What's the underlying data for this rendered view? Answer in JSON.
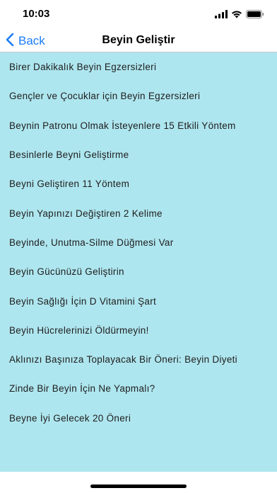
{
  "status": {
    "time": "10:03",
    "icons": [
      "signal-icon",
      "wifi-icon",
      "battery-icon"
    ]
  },
  "nav": {
    "back_label": "Back",
    "title": "Beyin Geliştir"
  },
  "colors": {
    "accent": "#1a7cf5",
    "list_background": "#aee6ef"
  },
  "items": [
    {
      "label": "Birer Dakikalık Beyin Egzersizleri"
    },
    {
      "label": "Gençler ve Çocuklar için Beyin Egzersizleri"
    },
    {
      "label": "Beynin Patronu Olmak İsteyenlere 15 Etkili Yöntem"
    },
    {
      "label": "Besinlerle Beyni Geliştirme"
    },
    {
      "label": "Beyni Geliştiren 11 Yöntem"
    },
    {
      "label": "Beyin Yapınızı Değiştiren 2 Kelime"
    },
    {
      "label": "Beyinde, Unutma-Silme Düğmesi Var"
    },
    {
      "label": "Beyin Gücünüzü Geliştirin"
    },
    {
      "label": "Beyin Sağlığı İçin D Vitamini Şart"
    },
    {
      "label": "Beyin Hücrelerinizi Öldürmeyin!"
    },
    {
      "label": "Aklınızı Başınıza Toplayacak Bir Öneri: Beyin Diyeti"
    },
    {
      "label": "Zinde Bir Beyin İçin Ne Yapmalı?"
    },
    {
      "label": "Beyne İyi Gelecek 20 Öneri"
    }
  ]
}
